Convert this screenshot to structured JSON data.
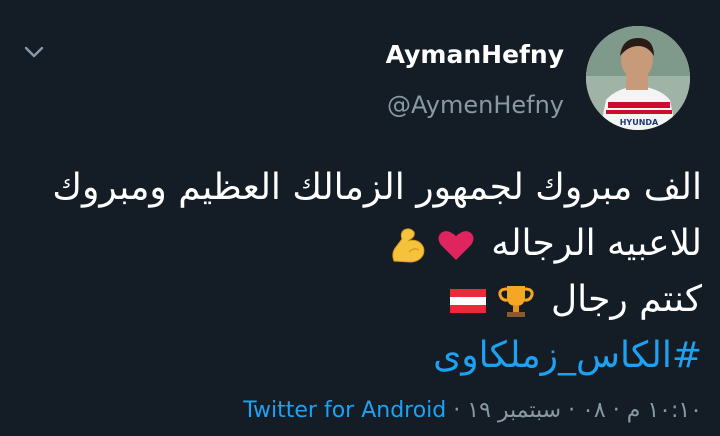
{
  "tweet": {
    "display_name": "AymanHefny",
    "handle": "@AymenHefny",
    "text_line_1": "الف مبروك لجمهور الزمالك العظيم ومبروك",
    "text_line_2": "للاعبيه الرجاله",
    "text_line_3": "كنتم رجال",
    "hashtag": "#الكاس_زملكاوى",
    "timestamp": "١٠:١٠ م · ٠٨ · سبتمبر ١٩",
    "separator": " · ",
    "source": "Twitter for Android",
    "avatar_jersey_text": "HYUNDA"
  },
  "icons": {
    "menu": "chevron-down-icon",
    "emoji_1": "red-heart-icon",
    "emoji_2": "flexed-biceps-icon",
    "emoji_3": "trophy-icon",
    "emoji_4": "austria-flag-icon"
  },
  "colors": {
    "background": "#141d26",
    "text": "#ffffff",
    "muted": "#8899a6",
    "link": "#1da1f2",
    "heart": "#e0245e",
    "biceps": "#f5c33b",
    "trophy": "#f5a623",
    "flag_red": "#ed2939"
  }
}
